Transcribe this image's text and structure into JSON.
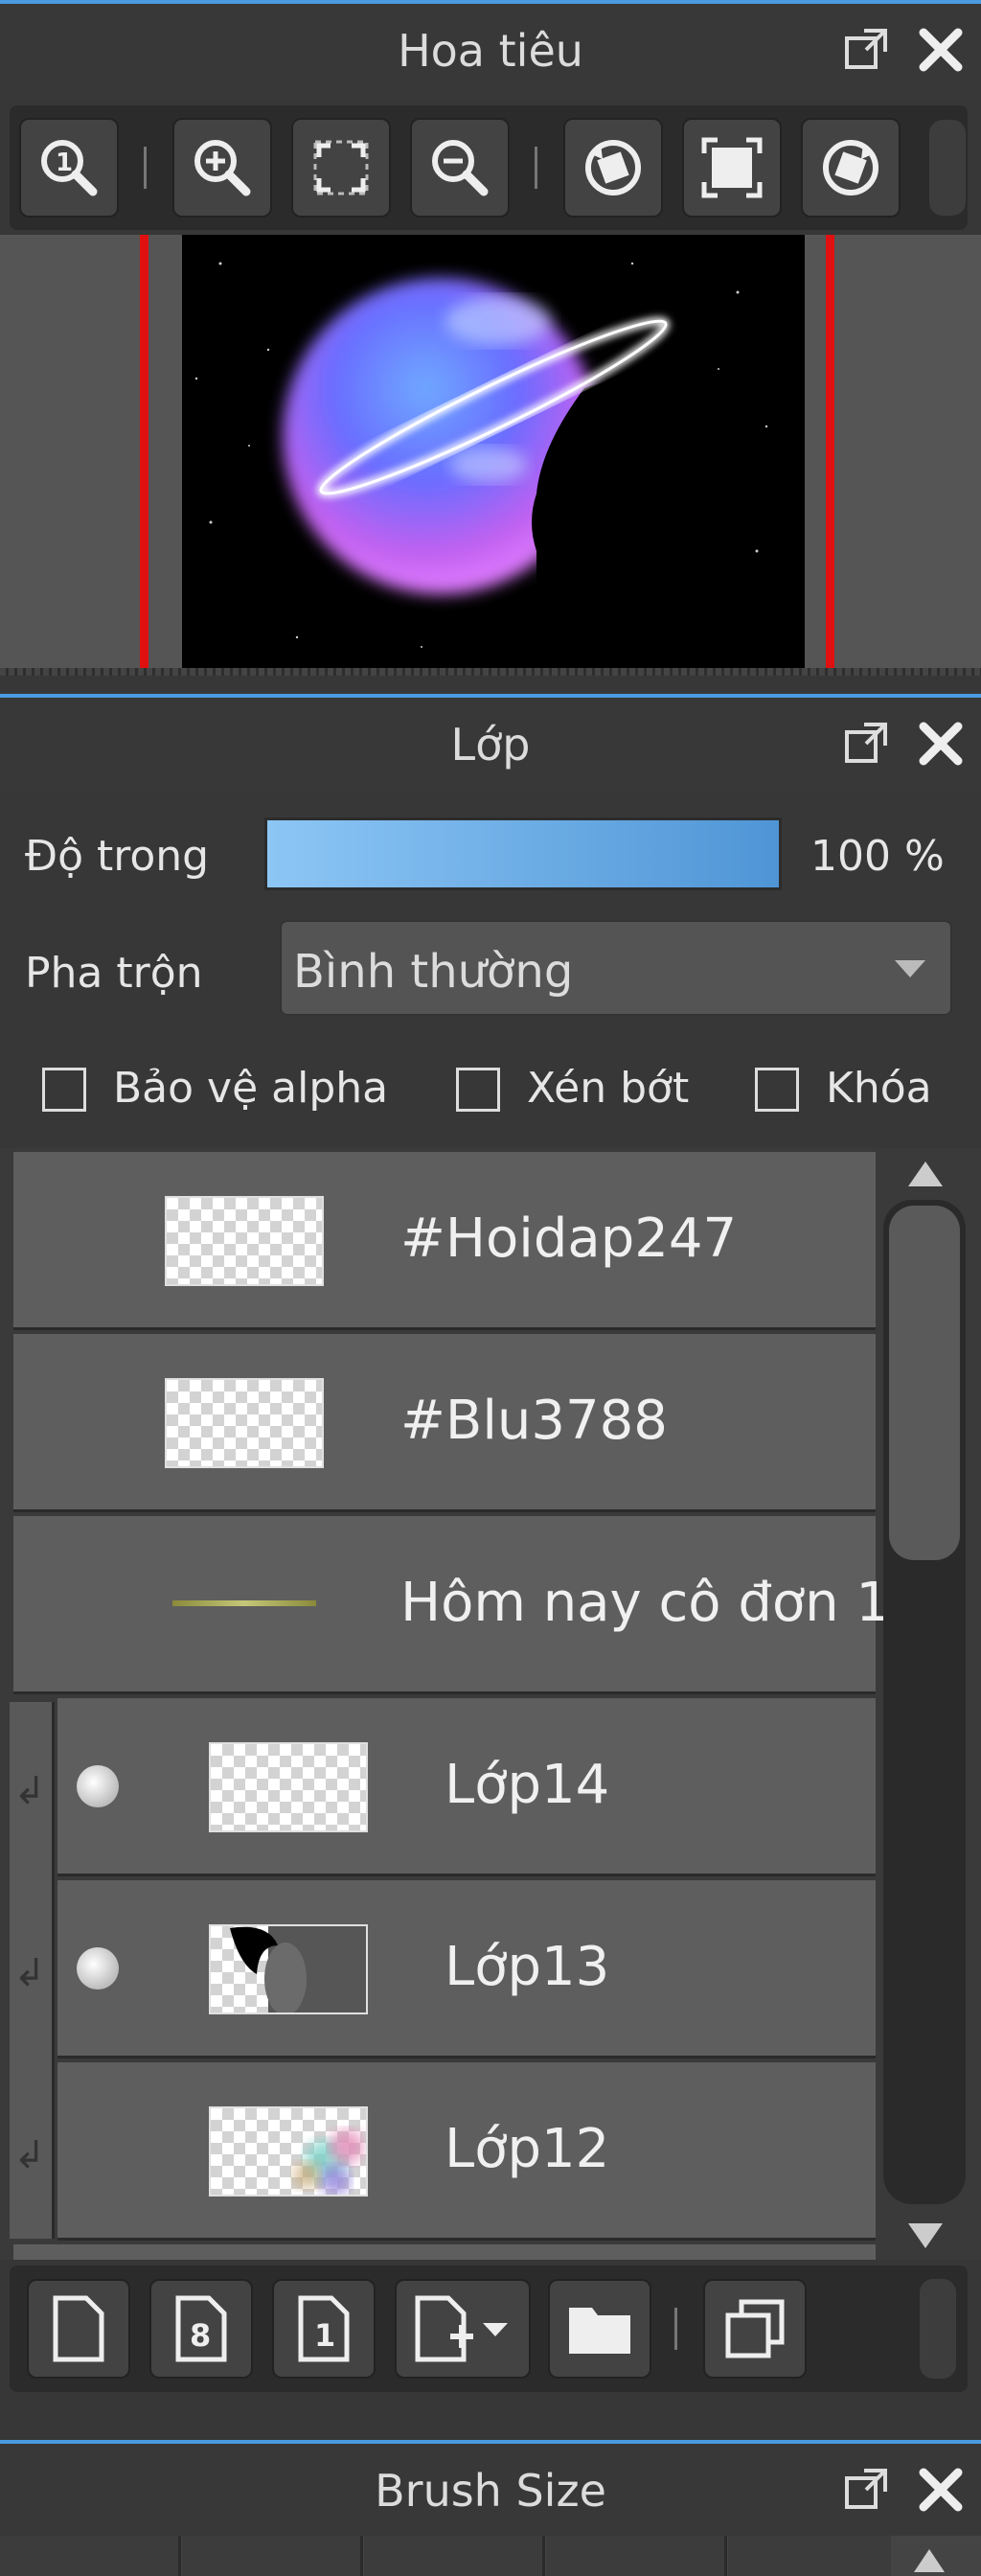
{
  "navigator": {
    "title": "Hoa tiêu",
    "tools": [
      "zoom-actual-icon",
      "zoom-in-icon",
      "fit-screen-icon",
      "zoom-out-icon",
      "rotate-left-icon",
      "full-screen-icon",
      "rotate-right-icon"
    ]
  },
  "layers_panel": {
    "title": "Lớp",
    "opacity_label": "Độ trong",
    "opacity_value": "100 %",
    "opacity": 1.0,
    "blend_label": "Pha trộn",
    "blend_value": "Bình thường",
    "protect_alpha_label": "Bảo vệ alpha",
    "clipping_label": "Xén bớt",
    "lock_label": "Khóa",
    "layers": [
      {
        "name": "#Hoidap247"
      },
      {
        "name": "#Blu3788"
      },
      {
        "name": "Hôm nay cô đơn 1"
      },
      {
        "name": "Lớp14"
      },
      {
        "name": "Lớp13"
      },
      {
        "name": "Lớp12"
      }
    ]
  },
  "brush_size": {
    "title": "Brush Size"
  },
  "colors": {
    "accent": "#4a9be0",
    "opacity_bar_start": "#8cc6f5",
    "opacity_bar_end": "#4f95d6"
  }
}
